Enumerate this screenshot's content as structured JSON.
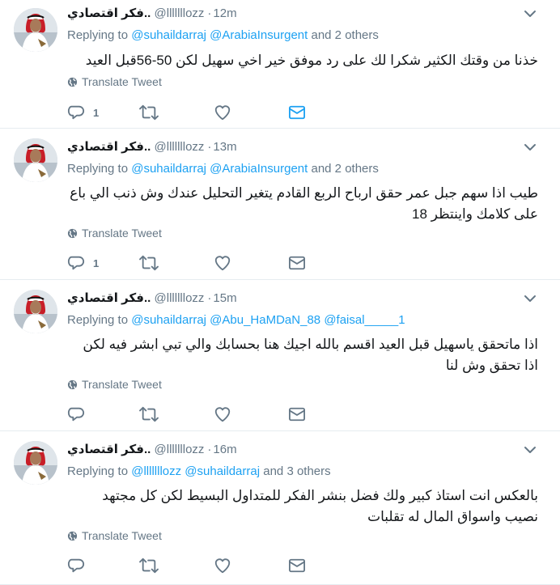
{
  "tweets": [
    {
      "name": "فكر اقتصادي..",
      "handle": "@lllllllozz",
      "time": "12m",
      "replying_prefix": "Replying to",
      "mentions": [
        "@suhaildarraj",
        "@ArabiaInsurgent"
      ],
      "replying_suffix": "and 2 others",
      "text": "خذنا من وقتك الكثير شكرا لك على رد موفق خير اخي سهيل لكن 50-56قبل العيد",
      "translate_label": "Translate Tweet",
      "reply_count": "1",
      "dm_active": true
    },
    {
      "name": "فكر اقتصادي..",
      "handle": "@lllllllozz",
      "time": "13m",
      "replying_prefix": "Replying to",
      "mentions": [
        "@suhaildarraj",
        "@ArabiaInsurgent"
      ],
      "replying_suffix": "and 2 others",
      "text": "طيب اذا سهم جبل عمر حقق ارباح الربع القادم يتغير التحليل عندك وش ذنب الي باع على كلامك واينتظر 18",
      "translate_label": "Translate Tweet",
      "reply_count": "1",
      "dm_active": false
    },
    {
      "name": "فكر اقتصادي..",
      "handle": "@lllllllozz",
      "time": "15m",
      "replying_prefix": "Replying to",
      "mentions": [
        "@suhaildarraj",
        "@Abu_HaMDaN_88",
        "@faisal_____1"
      ],
      "replying_suffix": "",
      "text": "اذا ماتحقق ياسهيل قبل العيد اقسم بالله اجيك هنا بحسابك والي تبي ابشر فيه لكن اذا تحقق وش لنا",
      "translate_label": "Translate Tweet",
      "reply_count": "",
      "dm_active": false
    },
    {
      "name": "فكر اقتصادي..",
      "handle": "@lllllllozz",
      "time": "16m",
      "replying_prefix": "Replying to",
      "mentions": [
        "@lllllllozz",
        "@suhaildarraj"
      ],
      "replying_suffix": "and 3 others",
      "text": "بالعكس انت استاذ كبير ولك فضل بنشر الفكر للمتداول البسيط لكن كل مجتهد نصيب واسواق المال له تقلبات",
      "translate_label": "Translate Tweet",
      "reply_count": "",
      "dm_active": false
    }
  ],
  "colors": {
    "link": "#1da1f2",
    "muted": "#657786",
    "text": "#14171a",
    "border": "#e6ecf0"
  },
  "icons": [
    "chevron-down-icon",
    "globe-icon",
    "reply-icon",
    "retweet-icon",
    "heart-icon",
    "envelope-icon"
  ]
}
